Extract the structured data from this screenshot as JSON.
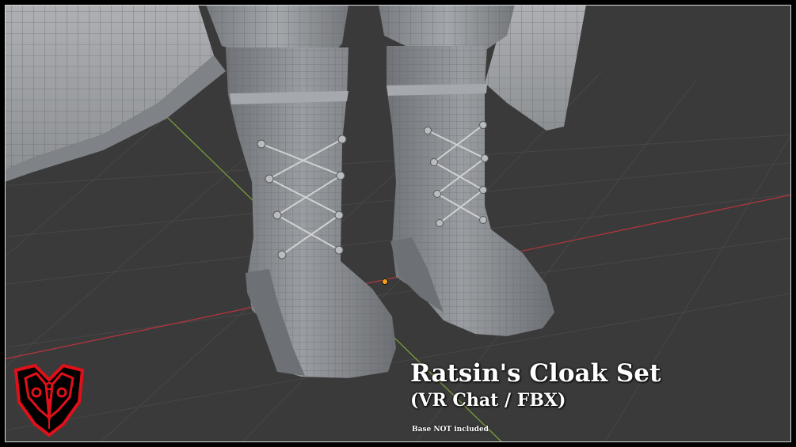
{
  "banner": {
    "title": "Ratsin's Cloak Set",
    "subtitle": "(VR Chat / FBX)",
    "note": "Base NOT included"
  },
  "logo": {
    "icon": "fox-mask-logo-icon",
    "color": "#e0101a"
  },
  "colors": {
    "viewport_background": "#3a3a3a",
    "grid_line": "#4a4a4a",
    "x_axis": "#b8353f",
    "y_axis": "#7aa53a",
    "origin": "#f0a020",
    "mesh_fill": "#8f9296",
    "mesh_wire": "#5b5e62"
  }
}
